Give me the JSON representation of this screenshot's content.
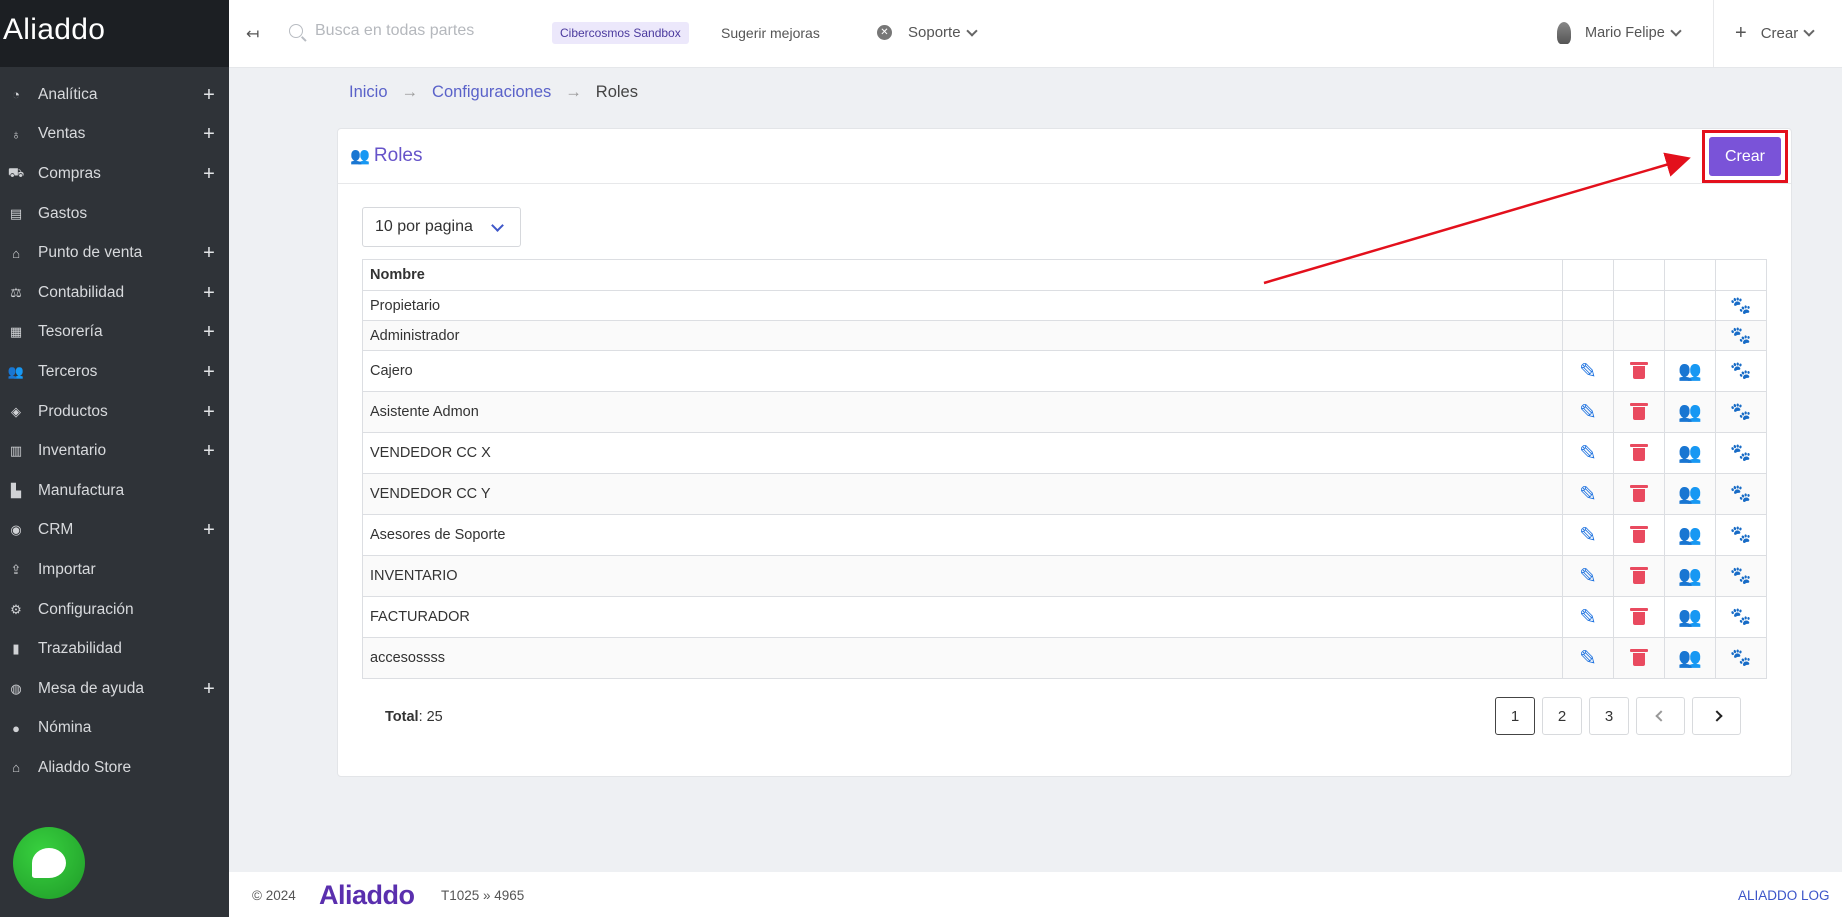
{
  "app": {
    "brand": "Aliaddo"
  },
  "sidebar": {
    "items": [
      {
        "label": "Analítica",
        "icon": "gauge-icon",
        "expandable": true
      },
      {
        "label": "Ventas",
        "icon": "money-bag-icon",
        "expandable": true
      },
      {
        "label": "Compras",
        "icon": "cart-icon",
        "expandable": true
      },
      {
        "label": "Gastos",
        "icon": "receipt-icon",
        "expandable": false
      },
      {
        "label": "Punto de venta",
        "icon": "store-icon",
        "expandable": true
      },
      {
        "label": "Contabilidad",
        "icon": "scale-icon",
        "expandable": true
      },
      {
        "label": "Tesorería",
        "icon": "cash-register-icon",
        "expandable": true
      },
      {
        "label": "Terceros",
        "icon": "users-icon",
        "expandable": true
      },
      {
        "label": "Productos",
        "icon": "tags-icon",
        "expandable": true
      },
      {
        "label": "Inventario",
        "icon": "pallet-icon",
        "expandable": true
      },
      {
        "label": "Manufactura",
        "icon": "industry-icon",
        "expandable": false
      },
      {
        "label": "CRM",
        "icon": "target-icon",
        "expandable": true
      },
      {
        "label": "Importar",
        "icon": "upload-icon",
        "expandable": false
      },
      {
        "label": "Configuración",
        "icon": "gears-icon",
        "expandable": false
      },
      {
        "label": "Trazabilidad",
        "icon": "chart-icon",
        "expandable": false
      },
      {
        "label": "Mesa de ayuda",
        "icon": "headset-icon",
        "expandable": true
      },
      {
        "label": "Nómina",
        "icon": "user-icon",
        "expandable": false
      },
      {
        "label": "Aliaddo Store",
        "icon": "shop-icon",
        "expandable": false
      }
    ]
  },
  "topbar": {
    "search_placeholder": "Busca en todas partes",
    "sandbox": "Cibercosmos Sandbox",
    "suggest": "Sugerir mejoras",
    "support": "Soporte",
    "user": "Mario Felipe",
    "create": "Crear"
  },
  "breadcrumb": {
    "home": "Inicio",
    "config": "Configuraciones",
    "current": "Roles",
    "separator": "→"
  },
  "card": {
    "title": "Roles",
    "create_button": "Crear",
    "per_page": "10 por pagina",
    "table": {
      "header": "Nombre",
      "rows": [
        {
          "name": "Propietario",
          "actions": false
        },
        {
          "name": "Administrador",
          "actions": false
        },
        {
          "name": "Cajero",
          "actions": true
        },
        {
          "name": "Asistente Admon",
          "actions": true
        },
        {
          "name": "VENDEDOR CC X",
          "actions": true
        },
        {
          "name": "VENDEDOR CC Y",
          "actions": true
        },
        {
          "name": "Asesores de Soporte",
          "actions": true
        },
        {
          "name": "INVENTARIO",
          "actions": true
        },
        {
          "name": "FACTURADOR",
          "actions": true
        },
        {
          "name": "accesossss",
          "actions": true
        }
      ]
    },
    "total_label": "Total",
    "total_value": ": 25",
    "pages": [
      "1",
      "2",
      "3"
    ],
    "active_page": "1"
  },
  "footer": {
    "copyright": "© 2024",
    "logo": "Aliaddo",
    "version": "T1025 » 4965",
    "log_link": "ALIADDO LOG"
  },
  "colors": {
    "accent": "#7a53d8",
    "highlight": "#e3101c",
    "sidebar": "#2f3338",
    "link": "#5a62c9"
  }
}
